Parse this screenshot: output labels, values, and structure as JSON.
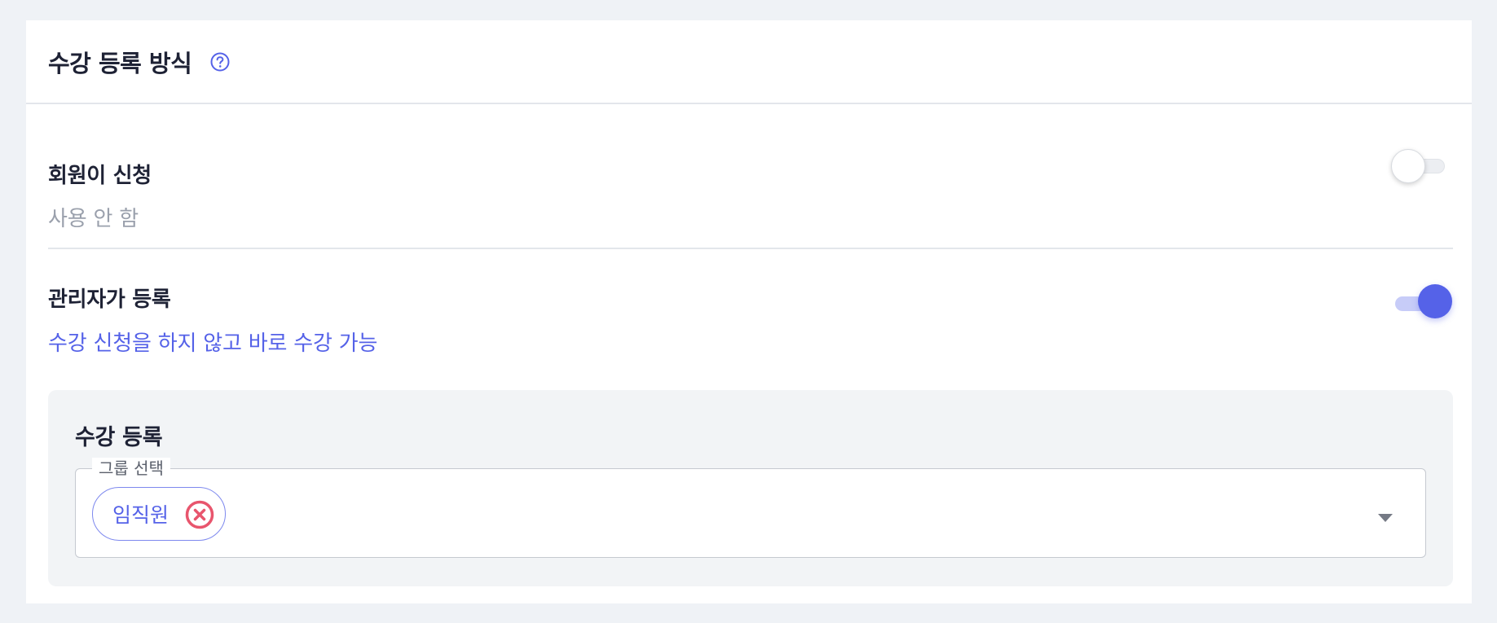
{
  "section": {
    "title": "수강 등록 방식",
    "help_icon": "question-circle-icon"
  },
  "options": {
    "member_request": {
      "title": "회원이 신청",
      "description": "사용 안 함",
      "enabled": false
    },
    "admin_register": {
      "title": "관리자가 등록",
      "description": "수강 신청을 하지 않고 바로 수강 가능",
      "enabled": true
    }
  },
  "enrollment": {
    "title": "수강 등록",
    "group_field": {
      "label": "그룹 선택",
      "selected": [
        {
          "label": "임직원",
          "remove_icon": "close-circle-icon"
        }
      ],
      "dropdown_icon": "caret-down-icon"
    }
  },
  "colors": {
    "accent": "#5562e8",
    "remove": "#e8556d",
    "background": "#eff2f6",
    "panel": "#f2f4f6"
  }
}
